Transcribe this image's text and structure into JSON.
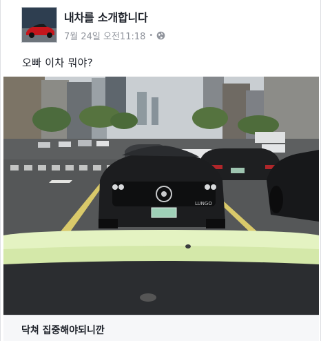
{
  "post": {
    "author": "내차를 소개합니다",
    "date": "7월 24일 오전11:18",
    "separator": "•",
    "privacy_icon": "globe-icon",
    "caption": "오빠 이차 뭐야?"
  },
  "attachment": {
    "photo_description_icon": "car-dashcam-photo",
    "plate_text": "LUNGO",
    "title": "닥쳐 집중해야되니깐"
  },
  "colors": {
    "link_blue": "#365899",
    "secondary_text": "#90949c",
    "primary_text": "#1d2129"
  }
}
